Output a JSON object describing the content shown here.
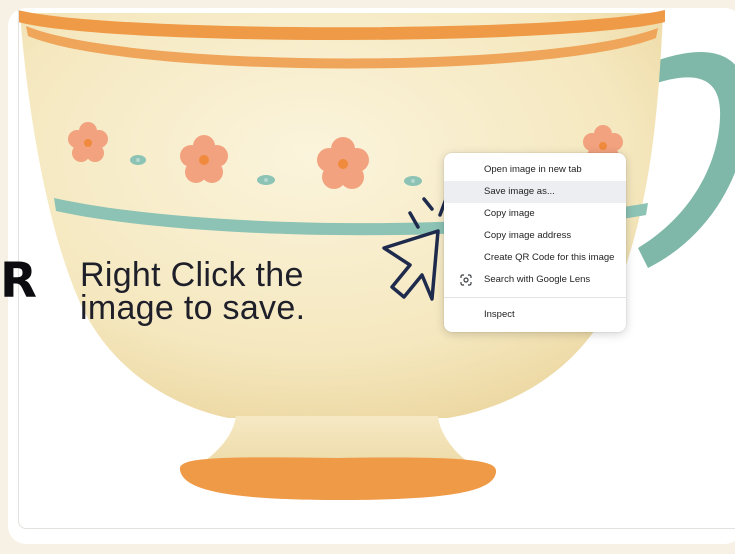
{
  "side_letter": "R",
  "instruction": {
    "line1": "Right Click the",
    "line2": "image to save."
  },
  "context_menu": {
    "items": [
      {
        "label": "Open image in new tab"
      },
      {
        "label": "Save image as...",
        "highlighted": true
      },
      {
        "label": "Copy image"
      },
      {
        "label": "Copy image address"
      },
      {
        "label": "Create QR Code for this image"
      },
      {
        "label": "Search with Google Lens",
        "icon": "google-lens-icon"
      },
      {
        "label": "Inspect"
      }
    ]
  },
  "colors": {
    "page_bg": "#f6f1e4",
    "cup_body": "#f7edc9",
    "cup_rim": "#ef9a46",
    "stripe_teal": "#8cc3b4",
    "flower": "#f2a27e",
    "handle": "#7fb8a8",
    "menu_hover": "#eceef1"
  }
}
